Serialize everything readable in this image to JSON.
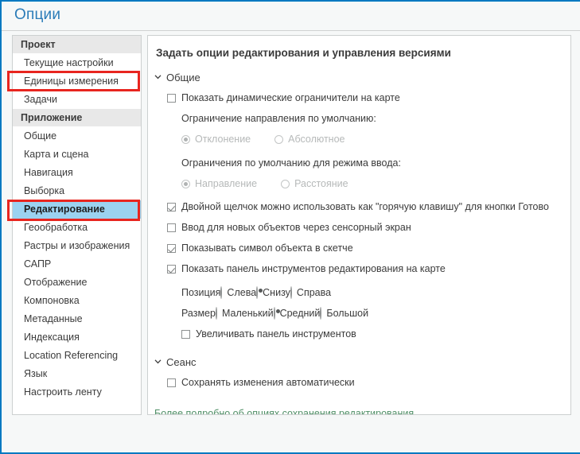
{
  "window": {
    "title": "Опции",
    "accent_blue": "#0079c1",
    "title_color": "#2b7cb8",
    "selection_color": "#9bd2f0",
    "highlight_box_color": "#e8251f",
    "link_color": "#4f8f66"
  },
  "sidebar": {
    "groups": [
      {
        "header": "Проект",
        "items": [
          {
            "label": "Текущие настройки",
            "selected": false,
            "highlighted": false
          },
          {
            "label": "Единицы измерения",
            "selected": false,
            "highlighted": true
          },
          {
            "label": "Задачи",
            "selected": false,
            "highlighted": false
          }
        ]
      },
      {
        "header": "Приложение",
        "items": [
          {
            "label": "Общие",
            "selected": false,
            "highlighted": false
          },
          {
            "label": "Карта и сцена",
            "selected": false,
            "highlighted": false
          },
          {
            "label": "Навигация",
            "selected": false,
            "highlighted": false
          },
          {
            "label": "Выборка",
            "selected": false,
            "highlighted": false
          },
          {
            "label": "Редактирование",
            "selected": true,
            "highlighted": true
          },
          {
            "label": "Геообработка",
            "selected": false,
            "highlighted": false
          },
          {
            "label": "Растры и изображения",
            "selected": false,
            "highlighted": false
          },
          {
            "label": "САПР",
            "selected": false,
            "highlighted": false
          },
          {
            "label": "Отображение",
            "selected": false,
            "highlighted": false
          },
          {
            "label": "Компоновка",
            "selected": false,
            "highlighted": false
          },
          {
            "label": "Метаданные",
            "selected": false,
            "highlighted": false
          },
          {
            "label": "Индексация",
            "selected": false,
            "highlighted": false
          },
          {
            "label": "Location Referencing",
            "selected": false,
            "highlighted": false
          },
          {
            "label": "Язык",
            "selected": false,
            "highlighted": false
          },
          {
            "label": "Настроить ленту",
            "selected": false,
            "highlighted": false
          }
        ]
      }
    ]
  },
  "main": {
    "title": "Задать опции редактирования и управления версиями",
    "section_general": {
      "header": "Общие",
      "cb_show_dynamic_constraints": {
        "label": "Показать динамические ограничители на карте",
        "checked": false
      },
      "direction_constraint_label": "Ограничение направления по умолчанию:",
      "direction_options": [
        {
          "label": "Отклонение",
          "selected": true,
          "disabled": true
        },
        {
          "label": "Абсолютное",
          "selected": false,
          "disabled": true
        }
      ],
      "input_constraint_label": "Ограничения по умолчанию для режима ввода:",
      "input_options": [
        {
          "label": "Направление",
          "selected": true,
          "disabled": true
        },
        {
          "label": "Расстояние",
          "selected": false,
          "disabled": true
        }
      ],
      "cb_double_click": {
        "label": "Двойной щелчок  можно использовать как \"горячую клавишу\" для кнопки Готово",
        "checked": true
      },
      "cb_touch_input": {
        "label": "Ввод для новых объектов через сенсорный экран",
        "checked": false
      },
      "cb_show_symbol": {
        "label": "Показывать символ объекта в скетче",
        "checked": true
      },
      "cb_show_toolbar": {
        "label": "Показать панель инструментов редактирования на карте",
        "checked": true
      },
      "position_row": {
        "name": "Позиция",
        "options": [
          {
            "label": "Слева",
            "selected": false
          },
          {
            "label": "Снизу",
            "selected": true
          },
          {
            "label": "Справа",
            "selected": false
          }
        ]
      },
      "size_row": {
        "name": "Размер",
        "options": [
          {
            "label": "Маленький",
            "selected": false
          },
          {
            "label": "Средний",
            "selected": true
          },
          {
            "label": "Большой",
            "selected": false
          }
        ]
      },
      "cb_magnify_toolbar": {
        "label": "Увеличивать панель инструментов",
        "checked": false
      }
    },
    "section_session": {
      "header": "Сеанс",
      "cb_auto_save": {
        "label": "Сохранять изменения автоматически",
        "checked": false
      }
    },
    "link": "Более подробно об опциях сохранения редактирования"
  }
}
